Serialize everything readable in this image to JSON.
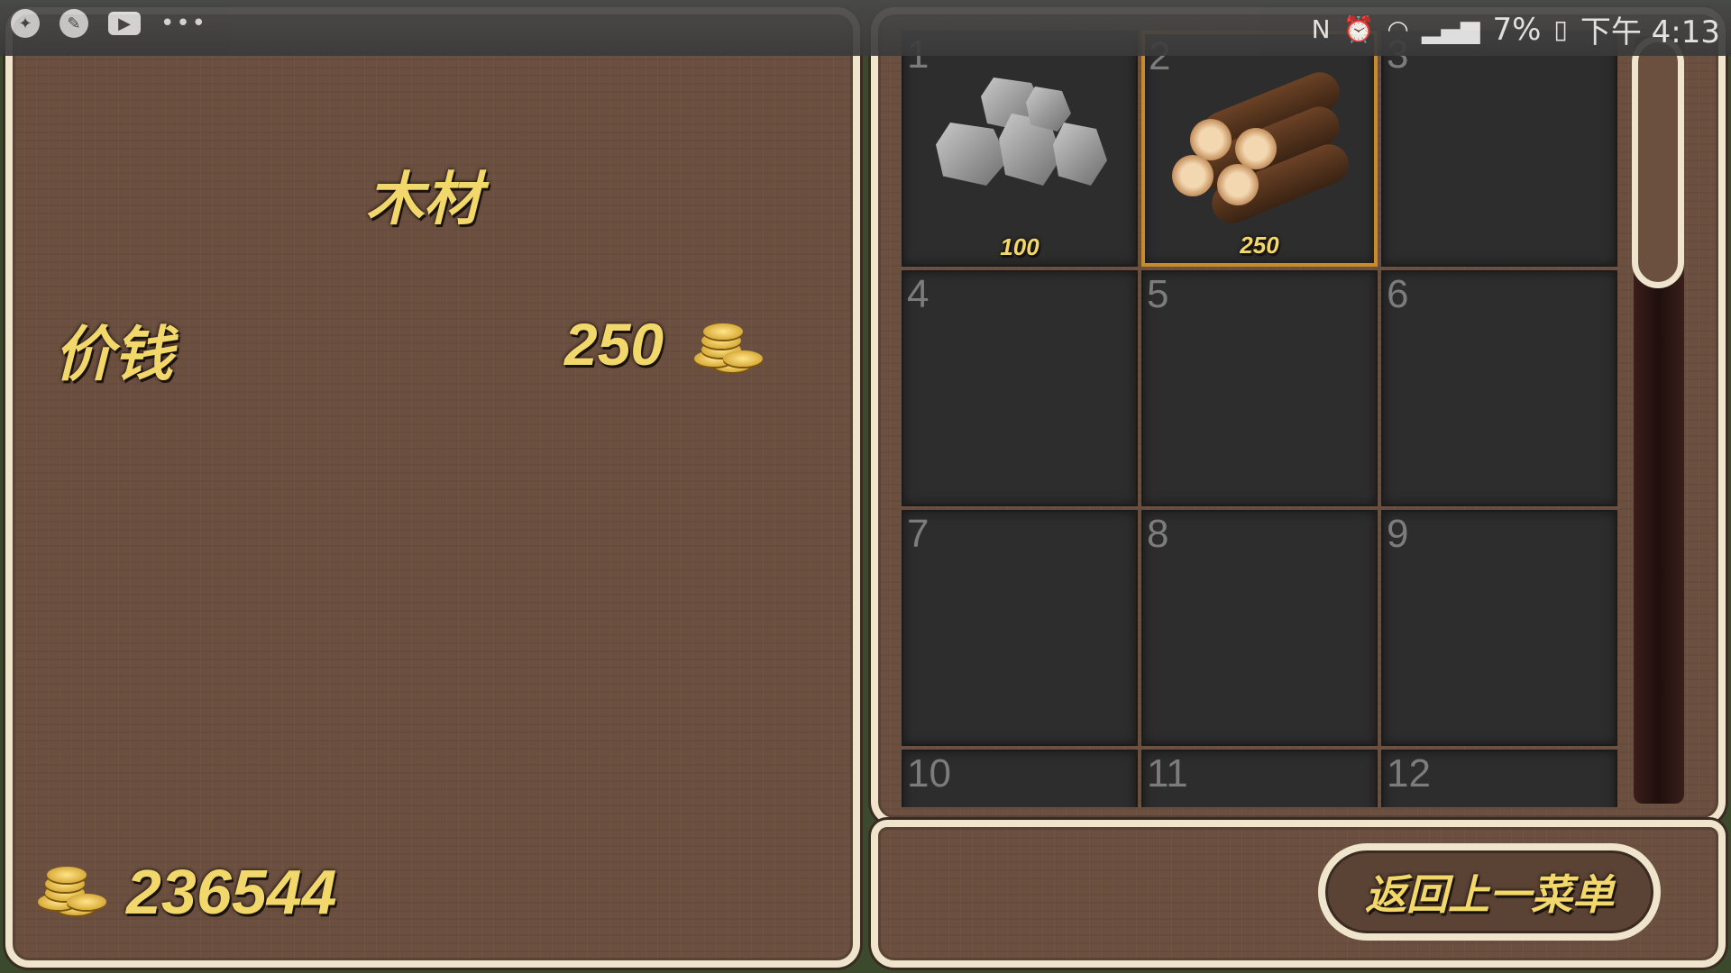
{
  "status_bar": {
    "left_icons": [
      "app-icon",
      "wrench-icon",
      "youtube-icon",
      "more-icon"
    ],
    "right": {
      "nfc": "N",
      "battery": "7%",
      "time": "下午 4:13"
    }
  },
  "detail": {
    "item_name": "木材",
    "price_label": "价钱",
    "price_value": "250",
    "total_gold": "236544"
  },
  "inventory": {
    "slots": [
      {
        "num": "1",
        "item": "stone",
        "price": "100"
      },
      {
        "num": "2",
        "item": "wood",
        "price": "250",
        "selected": true
      },
      {
        "num": "3"
      },
      {
        "num": "4"
      },
      {
        "num": "5"
      },
      {
        "num": "6"
      },
      {
        "num": "7"
      },
      {
        "num": "8"
      },
      {
        "num": "9"
      },
      {
        "num": "10"
      },
      {
        "num": "11"
      },
      {
        "num": "12"
      }
    ]
  },
  "back_button": "返回上一菜单",
  "colors": {
    "panel": "#6b4f3f",
    "border": "#efe5cc",
    "gold_text": "#f2d76a",
    "selected": "#c98a2a",
    "slot": "#2d2d2d"
  }
}
